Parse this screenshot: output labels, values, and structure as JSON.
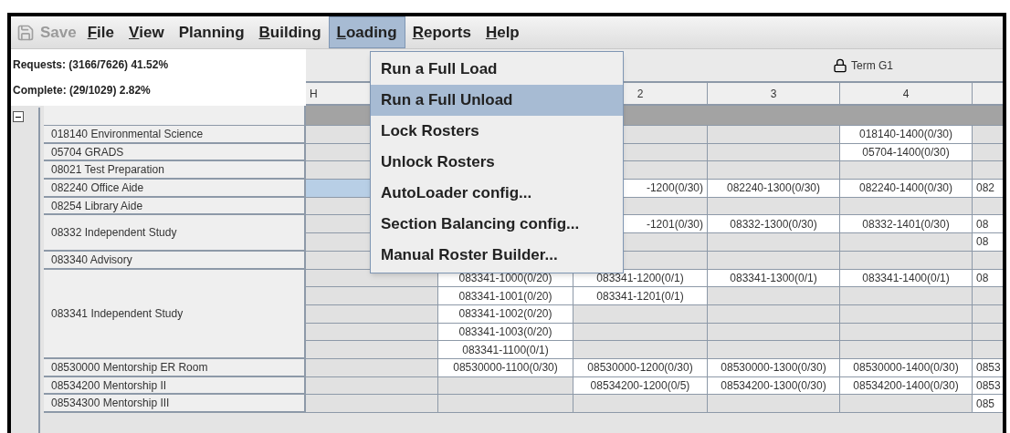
{
  "menu_bar": {
    "save": {
      "label": "Save",
      "disabled": true
    },
    "items": [
      {
        "label": "File",
        "underlined": true,
        "selected": false
      },
      {
        "label": "View",
        "underlined": true,
        "selected": false
      },
      {
        "label": "Planning",
        "underlined": false,
        "selected": false
      },
      {
        "label": "Building",
        "underlined": true,
        "selected": false
      },
      {
        "label": "Loading",
        "underlined": true,
        "selected": true
      },
      {
        "label": "Reports",
        "underlined": true,
        "selected": false
      },
      {
        "label": "Help",
        "underlined": true,
        "selected": false
      }
    ]
  },
  "loading_menu": [
    {
      "label": "Run a Full Load",
      "selected": false
    },
    {
      "label": "Run a Full Unload",
      "selected": true
    },
    {
      "label": "Lock Rosters",
      "selected": false
    },
    {
      "label": "Unlock Rosters",
      "selected": false
    },
    {
      "label": "AutoLoader config...",
      "selected": false
    },
    {
      "label": "Section Balancing config...",
      "selected": false
    },
    {
      "label": "Manual Roster Builder...",
      "selected": false
    }
  ],
  "status": {
    "requests": "Requests: (3166/7626) 41.52%",
    "complete": "Complete: (29/1029) 2.82%"
  },
  "term": {
    "label": "Term G1",
    "locked": true
  },
  "tree": {
    "expanded": true
  },
  "columns": [
    "H",
    null,
    "2",
    "3",
    "4",
    null
  ],
  "courses": [
    {
      "name": "018140 Environmental Science",
      "rows": [
        {
          "selected": false,
          "cells": [
            null,
            null,
            null,
            null,
            "018140-1400(0/30)",
            null
          ]
        }
      ]
    },
    {
      "name": "05704 GRADS",
      "rows": [
        {
          "selected": false,
          "cells": [
            null,
            null,
            null,
            null,
            "05704-1400(0/30)",
            null
          ]
        }
      ]
    },
    {
      "name": "08021 Test Preparation",
      "rows": [
        {
          "selected": false,
          "cells": [
            null,
            null,
            null,
            null,
            null,
            null
          ]
        }
      ]
    },
    {
      "name": "082240 Office Aide",
      "rows": [
        {
          "selected": true,
          "cells": [
            null,
            null,
            {
              "text": "-1200(0/30)",
              "kind": "clipped_right"
            },
            "082240-1300(0/30)",
            "082240-1400(0/30)",
            {
              "text": "082",
              "kind": "clipped_left"
            }
          ]
        }
      ]
    },
    {
      "name": "08254 Library Aide",
      "rows": [
        {
          "selected": false,
          "cells": [
            null,
            null,
            null,
            null,
            null,
            null
          ]
        }
      ]
    },
    {
      "name": "08332 Independent Study",
      "rows": [
        {
          "selected": false,
          "cells": [
            null,
            null,
            {
              "text": "-1201(0/30)",
              "kind": "clipped_right"
            },
            "08332-1300(0/30)",
            "08332-1401(0/30)",
            {
              "text": "08",
              "kind": "clipped_left"
            }
          ]
        },
        {
          "selected": false,
          "cells": [
            null,
            null,
            null,
            null,
            null,
            {
              "text": "08",
              "kind": "clipped_left"
            }
          ]
        }
      ]
    },
    {
      "name": "083340 Advisory",
      "rows": [
        {
          "selected": false,
          "cells": [
            null,
            null,
            null,
            null,
            null,
            null
          ]
        }
      ]
    },
    {
      "name": "083341 Independent Study",
      "rows": [
        {
          "selected": false,
          "cells": [
            null,
            "083341-1000(0/20)",
            "083341-1200(0/1)",
            "083341-1300(0/1)",
            "083341-1400(0/1)",
            {
              "text": "08",
              "kind": "clipped_left"
            }
          ]
        },
        {
          "selected": false,
          "cells": [
            null,
            "083341-1001(0/20)",
            "083341-1201(0/1)",
            null,
            null,
            null
          ]
        },
        {
          "selected": false,
          "cells": [
            null,
            "083341-1002(0/20)",
            null,
            null,
            null,
            null
          ]
        },
        {
          "selected": false,
          "cells": [
            null,
            "083341-1003(0/20)",
            null,
            null,
            null,
            null
          ]
        },
        {
          "selected": false,
          "cells": [
            null,
            "083341-1100(0/1)",
            null,
            null,
            null,
            null
          ]
        }
      ]
    },
    {
      "name": "08530000 Mentorship ER Room",
      "rows": [
        {
          "selected": false,
          "cells": [
            null,
            "08530000-1100(0/30)",
            "08530000-1200(0/30)",
            "08530000-1300(0/30)",
            "08530000-1400(0/30)",
            {
              "text": "0853",
              "kind": "clipped_left"
            }
          ]
        }
      ]
    },
    {
      "name": "08534200 Mentorship II",
      "rows": [
        {
          "selected": false,
          "cells": [
            null,
            null,
            "08534200-1200(0/5)",
            "08534200-1300(0/30)",
            "08534200-1400(0/30)",
            {
              "text": "0853",
              "kind": "clipped_left"
            }
          ]
        }
      ]
    },
    {
      "name": "08534300 Mentorship III",
      "rows": [
        {
          "selected": false,
          "cells": [
            null,
            null,
            null,
            null,
            null,
            {
              "text": "085",
              "kind": "clipped_left"
            }
          ]
        }
      ]
    }
  ]
}
